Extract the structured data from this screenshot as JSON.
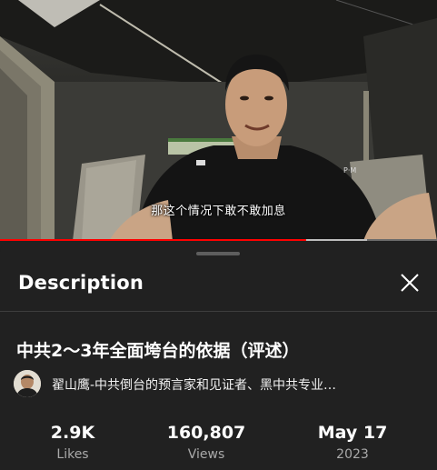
{
  "video": {
    "subtitle": "那这个情况下敢不敢加息",
    "progress_fraction": 0.7,
    "buffer_fraction": 0.84,
    "progress_color": "#ff0000"
  },
  "sheet": {
    "title": "Description",
    "close_icon": "close-icon"
  },
  "details": {
    "video_title": "中共2～3年全面垮台的依据（评述）",
    "channel_name": "翟山鹰-中共倒台的预言家和见证者、黑中共专业…"
  },
  "stats": [
    {
      "value": "2.9K",
      "label": "Likes"
    },
    {
      "value": "160,807",
      "label": "Views"
    },
    {
      "value": "May 17",
      "label": "2023"
    }
  ]
}
